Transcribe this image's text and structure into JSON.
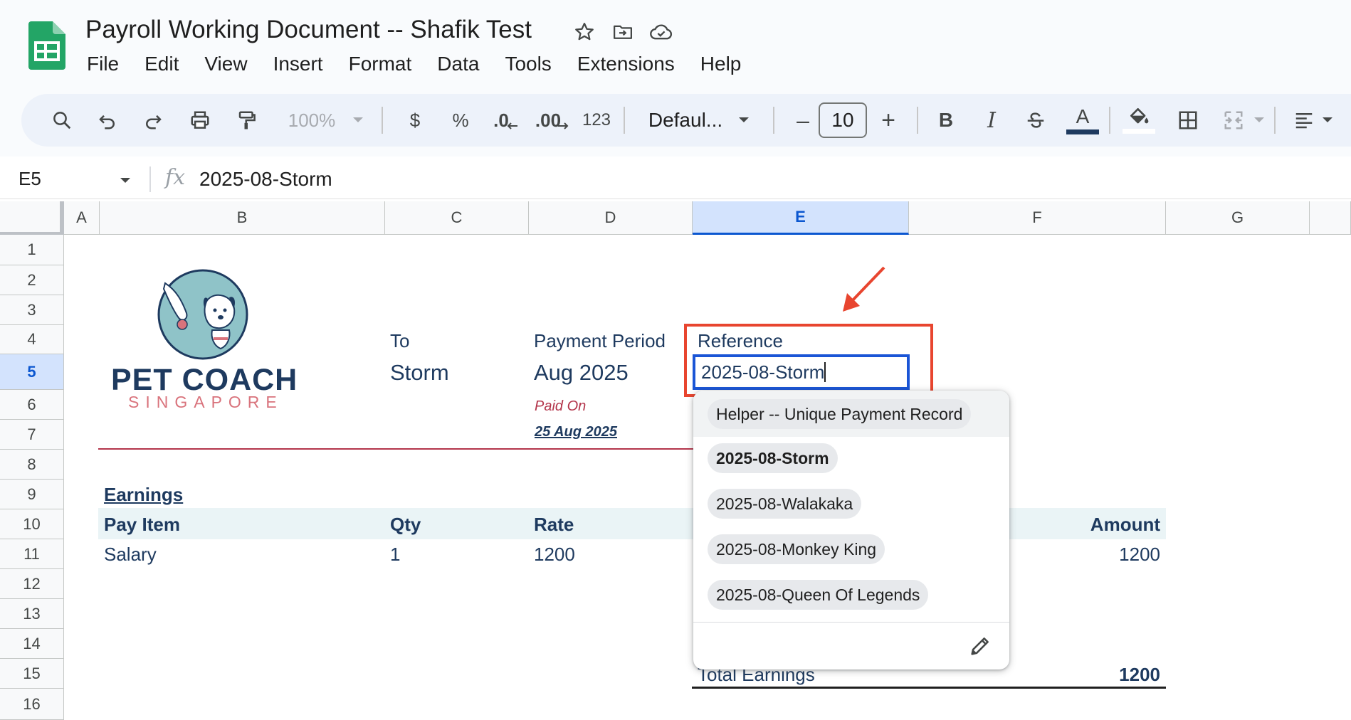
{
  "header": {
    "title": "Payroll Working Document -- Shafik Test",
    "menu": [
      "File",
      "Edit",
      "View",
      "Insert",
      "Format",
      "Data",
      "Tools",
      "Extensions",
      "Help"
    ]
  },
  "toolbar": {
    "zoom": "100%",
    "currency": "$",
    "percent": "%",
    "decrease_decimal": ".0",
    "increase_decimal": ".00",
    "number_format": "123",
    "font": "Defaul...",
    "minus": "–",
    "font_size": "10",
    "plus": "+",
    "bold": "B",
    "italic": "I",
    "text_color_letter": "A"
  },
  "formula_bar": {
    "cell_ref": "E5",
    "fx": "fx",
    "value": "2025-08-Storm"
  },
  "grid": {
    "columns": [
      "A",
      "B",
      "C",
      "D",
      "E",
      "F",
      "G"
    ],
    "active_column": "E",
    "rows": [
      "1",
      "2",
      "3",
      "4",
      "5",
      "6",
      "7",
      "8",
      "9",
      "10",
      "11",
      "12",
      "13",
      "14",
      "15",
      "16"
    ],
    "active_row": "5"
  },
  "sheet": {
    "logo": {
      "line1": "PET COACH",
      "line2": "SINGAPORE"
    },
    "to_label": "To",
    "to_value": "Storm",
    "period_label": "Payment Period",
    "period_value": "Aug 2025",
    "paid_on_label": "Paid On",
    "paid_on_value": "25 Aug 2025",
    "reference_label": "Reference",
    "reference_value": "2025-08-Storm",
    "earnings_title": "Earnings",
    "table": {
      "headers": {
        "pay_item": "Pay Item",
        "qty": "Qty",
        "rate": "Rate",
        "amount": "Amount"
      },
      "rows": [
        {
          "pay_item": "Salary",
          "qty": "1",
          "rate": "1200",
          "amount": "1200"
        }
      ]
    },
    "total_label": "Total Earnings",
    "total_value": "1200"
  },
  "dropdown": {
    "header": "Helper -- Unique Payment Record",
    "options": [
      "2025-08-Storm",
      "2025-08-Walakaka",
      "2025-08-Monkey King",
      "2025-08-Queen Of Legends"
    ],
    "selected": "2025-08-Storm"
  },
  "colors": {
    "accent_blue": "#0b57d0",
    "annotation_red": "#e8452f",
    "brand_navy": "#1e3a5f",
    "brand_pink": "#d9737c",
    "sheets_green": "#0f9d58"
  }
}
